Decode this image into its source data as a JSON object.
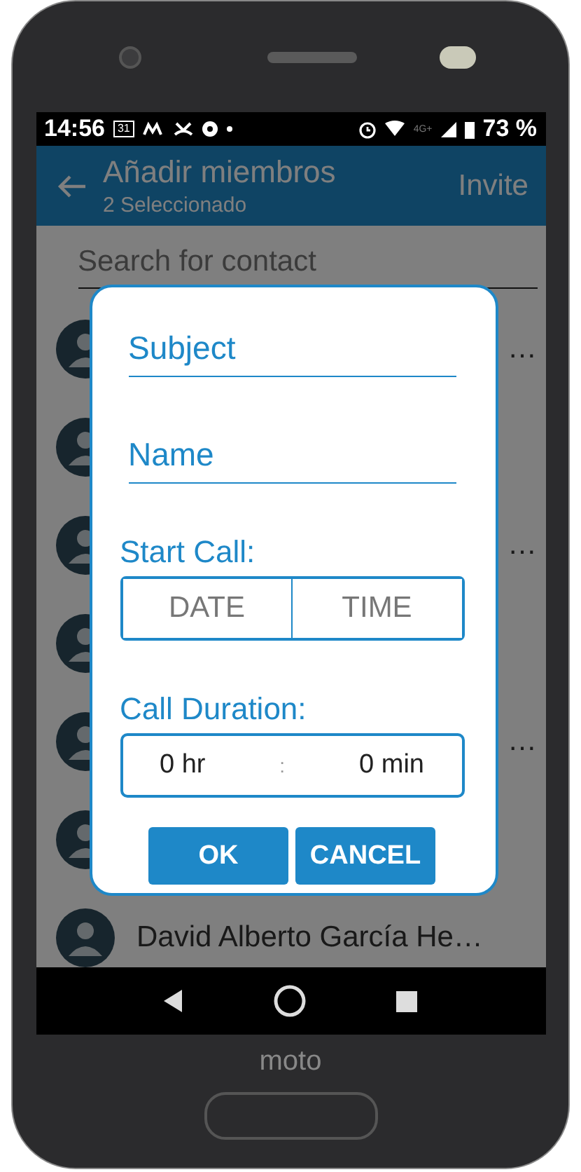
{
  "status_bar": {
    "time": "14:56",
    "calendar_day": "31",
    "battery": "73 %",
    "network": "4G+"
  },
  "app_bar": {
    "title": "Añadir miembros",
    "subtitle": "2 Seleccionado",
    "action": "Invite"
  },
  "search": {
    "placeholder": "Search for contact"
  },
  "contacts": [
    {
      "kind": "named",
      "name": "…"
    },
    {
      "kind": "covered"
    },
    {
      "kind": "named",
      "name": "…"
    },
    {
      "kind": "covered"
    },
    {
      "kind": "named",
      "name": "…"
    },
    {
      "kind": "covered"
    },
    {
      "kind": "named",
      "name": "David Alberto García He…"
    }
  ],
  "dialog": {
    "subject": {
      "placeholder": "Subject"
    },
    "name": {
      "placeholder": "Name"
    },
    "start_label": "Start Call:",
    "date_button": "DATE",
    "time_button": "TIME",
    "duration_label": "Call Duration:",
    "hours": "0 hr",
    "separator": ":",
    "minutes": "0 min",
    "buttons": [
      "OK",
      "CANCEL"
    ]
  },
  "brand": "moto"
}
